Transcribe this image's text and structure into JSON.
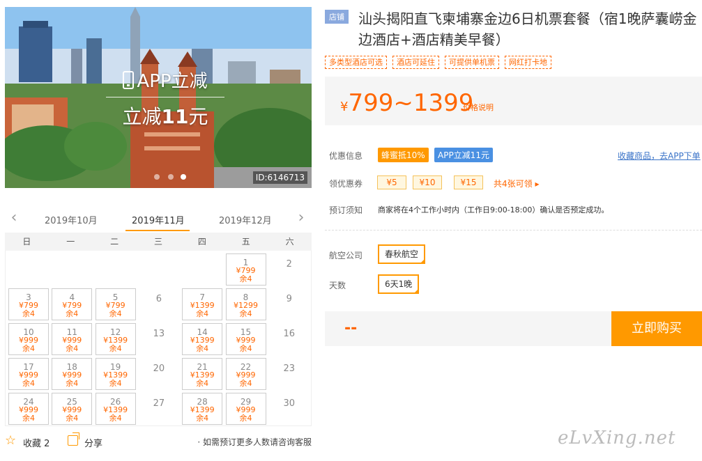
{
  "hero": {
    "promo_line1": "APP立减",
    "promo_line2_prefix": "立减",
    "promo_line2_amount": "11",
    "promo_line2_suffix": "元",
    "image_id": "ID:6146713",
    "slide_count": 3,
    "active_slide": 3
  },
  "calendar": {
    "prev_icon": "chevron-left-icon",
    "next_icon": "chevron-right-icon",
    "months": [
      "2019年10月",
      "2019年11月",
      "2019年12月"
    ],
    "active_month": "2019年11月",
    "weekdays": [
      "日",
      "一",
      "二",
      "三",
      "四",
      "五",
      "六"
    ],
    "rows": [
      [
        null,
        null,
        null,
        null,
        null,
        {
          "d": "1",
          "p": "¥799",
          "s": "余4"
        },
        {
          "d": "2"
        }
      ],
      [
        {
          "d": "3",
          "p": "¥799",
          "s": "余4"
        },
        {
          "d": "4",
          "p": "¥799",
          "s": "余4"
        },
        {
          "d": "5",
          "p": "¥799",
          "s": "余4"
        },
        {
          "d": "6"
        },
        {
          "d": "7",
          "p": "¥1399",
          "s": "余4"
        },
        {
          "d": "8",
          "p": "¥1299",
          "s": "余4"
        },
        {
          "d": "9"
        }
      ],
      [
        {
          "d": "10",
          "p": "¥999",
          "s": "余4"
        },
        {
          "d": "11",
          "p": "¥999",
          "s": "余4"
        },
        {
          "d": "12",
          "p": "¥1399",
          "s": "余4"
        },
        {
          "d": "13"
        },
        {
          "d": "14",
          "p": "¥1399",
          "s": "余4"
        },
        {
          "d": "15",
          "p": "¥999",
          "s": "余4"
        },
        {
          "d": "16"
        }
      ],
      [
        {
          "d": "17",
          "p": "¥999",
          "s": "余4"
        },
        {
          "d": "18",
          "p": "¥999",
          "s": "余4"
        },
        {
          "d": "19",
          "p": "¥1399",
          "s": "余4"
        },
        {
          "d": "20"
        },
        {
          "d": "21",
          "p": "¥1399",
          "s": "余4"
        },
        {
          "d": "22",
          "p": "¥999",
          "s": "余4"
        },
        {
          "d": "23"
        }
      ],
      [
        {
          "d": "24",
          "p": "¥999",
          "s": "余4"
        },
        {
          "d": "25",
          "p": "¥999",
          "s": "余4"
        },
        {
          "d": "26",
          "p": "¥1399",
          "s": "余4"
        },
        {
          "d": "27"
        },
        {
          "d": "28",
          "p": "¥1399",
          "s": "余4"
        },
        {
          "d": "29",
          "p": "¥999",
          "s": "余4"
        },
        {
          "d": "30"
        }
      ]
    ]
  },
  "footer": {
    "favorite_label": "收藏",
    "favorite_count": "2",
    "share_label": "分享",
    "note": "· 如需预订更多人数请咨询客服"
  },
  "product": {
    "shop_badge": "店铺",
    "title": "汕头揭阳直飞柬埔寨金边6日机票套餐（宿1晚萨囊崂金边酒店+酒店精美早餐）",
    "tags": [
      "多类型酒店可选",
      "酒店可延住",
      "可提供单机票",
      "网红打卡地"
    ],
    "price_currency": "¥",
    "price_range": "799~1399",
    "price_explain": "价格说明"
  },
  "promo": {
    "label": "优惠信息",
    "badge1": "蜂蜜抵10%",
    "badge2": "APP立减11元",
    "link": "收藏商品，去APP下单"
  },
  "coupons": {
    "label": "领优惠券",
    "items": [
      "¥5",
      "¥10",
      "¥15"
    ],
    "more": "共4张可领 ▸"
  },
  "booking": {
    "label": "预订须知",
    "text": "商家将在4个工作小时内（工作日9:00-18:00）确认是否预定成功。"
  },
  "options": {
    "airline_label": "航空公司",
    "airline_value": "春秋航空",
    "days_label": "天数",
    "days_value": "6天1晚"
  },
  "buy": {
    "total": "--",
    "button": "立即购买"
  },
  "watermark": "eLvXing.net",
  "colors": {
    "accent": "#ff9900",
    "price": "#ff6600",
    "shop_badge": "#8aa9de",
    "app_badge": "#4a90e2"
  }
}
